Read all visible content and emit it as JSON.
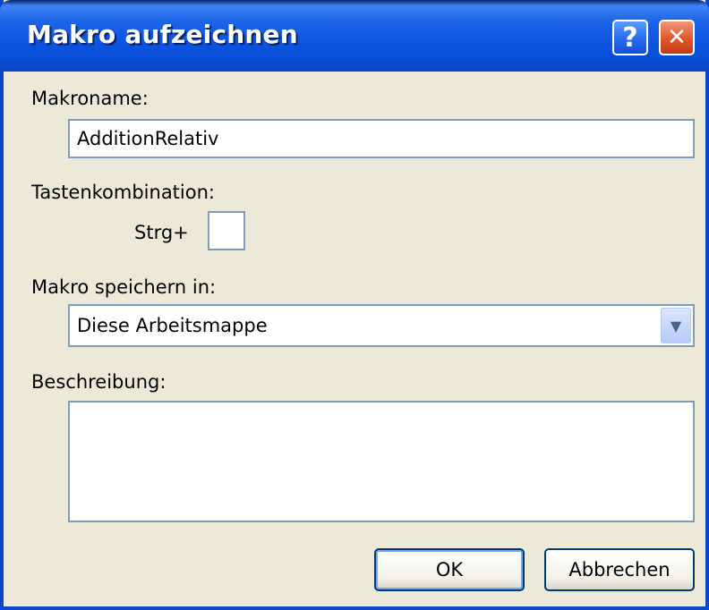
{
  "window": {
    "title": "Makro aufzeichnen",
    "help_symbol": "?",
    "close_symbol": "✕"
  },
  "form": {
    "macro_name_label": "Makroname:",
    "macro_name_value": "AdditionRelativ",
    "shortcut_label": "Tastenkombination:",
    "shortcut_prefix": "Strg+",
    "shortcut_value": "",
    "store_in_label": "Makro speichern in:",
    "store_in_value": "Diese Arbeitsmappe",
    "description_label": "Beschreibung:",
    "description_value": ""
  },
  "buttons": {
    "ok": "OK",
    "cancel": "Abbrechen"
  }
}
